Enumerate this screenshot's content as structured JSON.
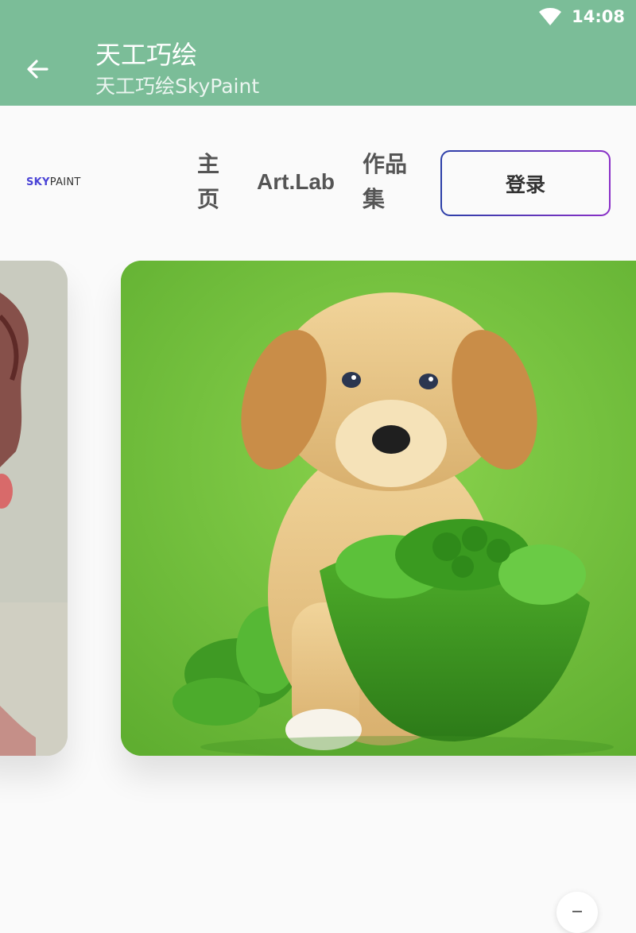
{
  "status_bar": {
    "time": "14:08",
    "wifi_icon": "wifi-icon"
  },
  "app_bar": {
    "back_icon": "arrow-left-icon",
    "title": "天工巧绘",
    "subtitle": "天工巧绘SkyPaint"
  },
  "nav": {
    "logo_sky": "SKY",
    "logo_paint": "PAINT",
    "home_label": "主页",
    "artlab_label": "Art.Lab",
    "works_label": "作品集",
    "login_label": "登录"
  },
  "carousel": {
    "left_card": "portrait-image",
    "main_card": "puppy-with-bowl-image"
  },
  "colors": {
    "app_bar": "#7bbd98",
    "login_border_start": "#2b3fa8",
    "login_border_end": "#8a2fc7",
    "card_background": "#74c23e"
  }
}
